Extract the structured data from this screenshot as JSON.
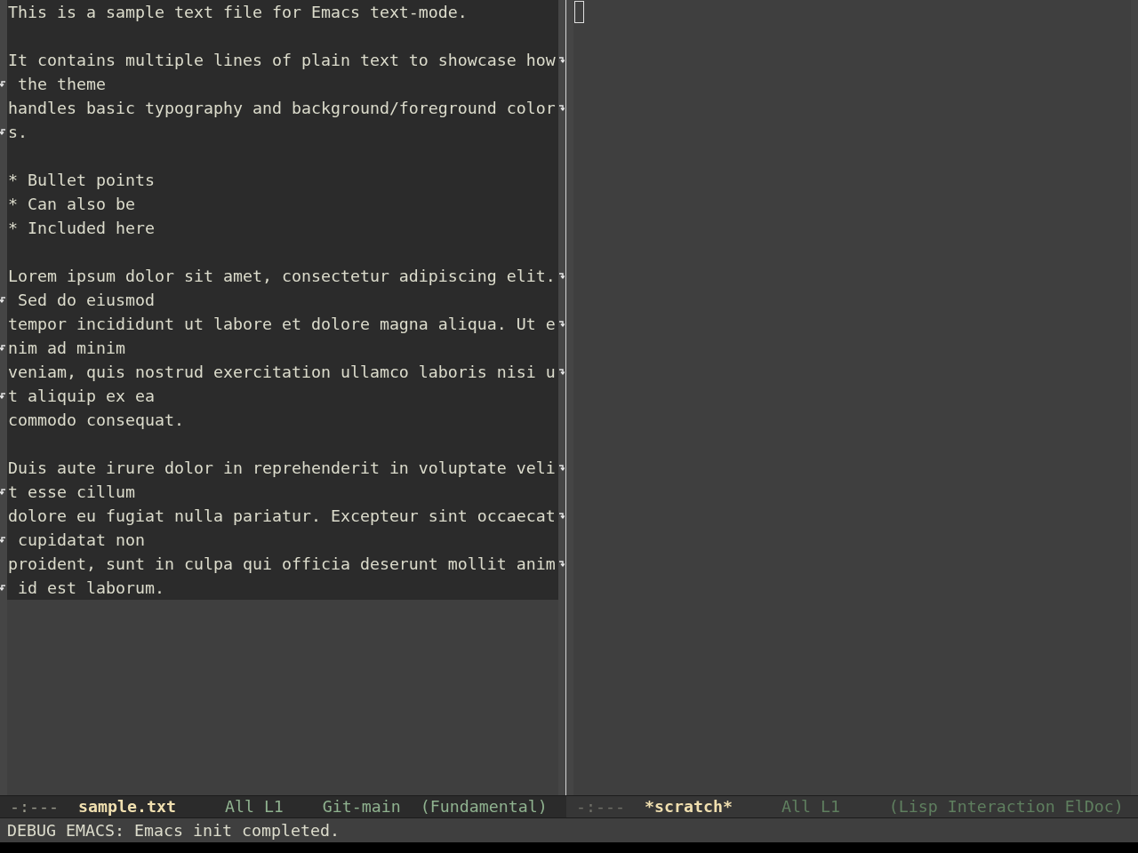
{
  "windows": [
    {
      "selected": true,
      "cursor": false,
      "paragraphs": [
        {
          "lines": [
            {
              "text": "This is a sample text file for Emacs text-mode.",
              "wrapped": false,
              "continuation": false
            }
          ]
        },
        {
          "lines": [
            {
              "text": "It contains multiple lines of plain text to showcase how",
              "wrapped": true,
              "continuation": false
            },
            {
              "text": " the theme",
              "wrapped": false,
              "continuation": true
            },
            {
              "text": "handles basic typography and background/foreground color",
              "wrapped": true,
              "continuation": false
            },
            {
              "text": "s.",
              "wrapped": false,
              "continuation": true
            }
          ]
        },
        {
          "lines": [
            {
              "text": "* Bullet points",
              "wrapped": false,
              "continuation": false
            },
            {
              "text": "* Can also be",
              "wrapped": false,
              "continuation": false
            },
            {
              "text": "* Included here",
              "wrapped": false,
              "continuation": false
            }
          ]
        },
        {
          "lines": [
            {
              "text": "Lorem ipsum dolor sit amet, consectetur adipiscing elit.",
              "wrapped": true,
              "continuation": false
            },
            {
              "text": " Sed do eiusmod",
              "wrapped": false,
              "continuation": true
            },
            {
              "text": "tempor incididunt ut labore et dolore magna aliqua. Ut e",
              "wrapped": true,
              "continuation": false
            },
            {
              "text": "nim ad minim",
              "wrapped": false,
              "continuation": true
            },
            {
              "text": "veniam, quis nostrud exercitation ullamco laboris nisi u",
              "wrapped": true,
              "continuation": false
            },
            {
              "text": "t aliquip ex ea",
              "wrapped": false,
              "continuation": true
            },
            {
              "text": "commodo consequat.",
              "wrapped": false,
              "continuation": false
            }
          ]
        },
        {
          "lines": [
            {
              "text": "Duis aute irure dolor in reprehenderit in voluptate veli",
              "wrapped": true,
              "continuation": false
            },
            {
              "text": "t esse cillum",
              "wrapped": false,
              "continuation": true
            },
            {
              "text": "dolore eu fugiat nulla pariatur. Excepteur sint occaecat",
              "wrapped": true,
              "continuation": false
            },
            {
              "text": " cupidatat non",
              "wrapped": false,
              "continuation": true
            },
            {
              "text": "proident, sunt in culpa qui officia deserunt mollit anim",
              "wrapped": true,
              "continuation": false
            },
            {
              "text": " id est laborum.",
              "wrapped": false,
              "continuation": true
            }
          ]
        }
      ],
      "mode_line": {
        "status": "-:---",
        "buffer_name": "sample.txt",
        "position": "All L1",
        "vc": "Git-main",
        "modes": "(Fundamental)"
      }
    },
    {
      "selected": false,
      "cursor": true,
      "mode_line": {
        "status": "-:---",
        "buffer_name": "*scratch*",
        "position": "All L1",
        "modes": "(Lisp Interaction ElDoc)"
      }
    }
  ],
  "echo_area": "DEBUG EMACS: Emacs init completed."
}
